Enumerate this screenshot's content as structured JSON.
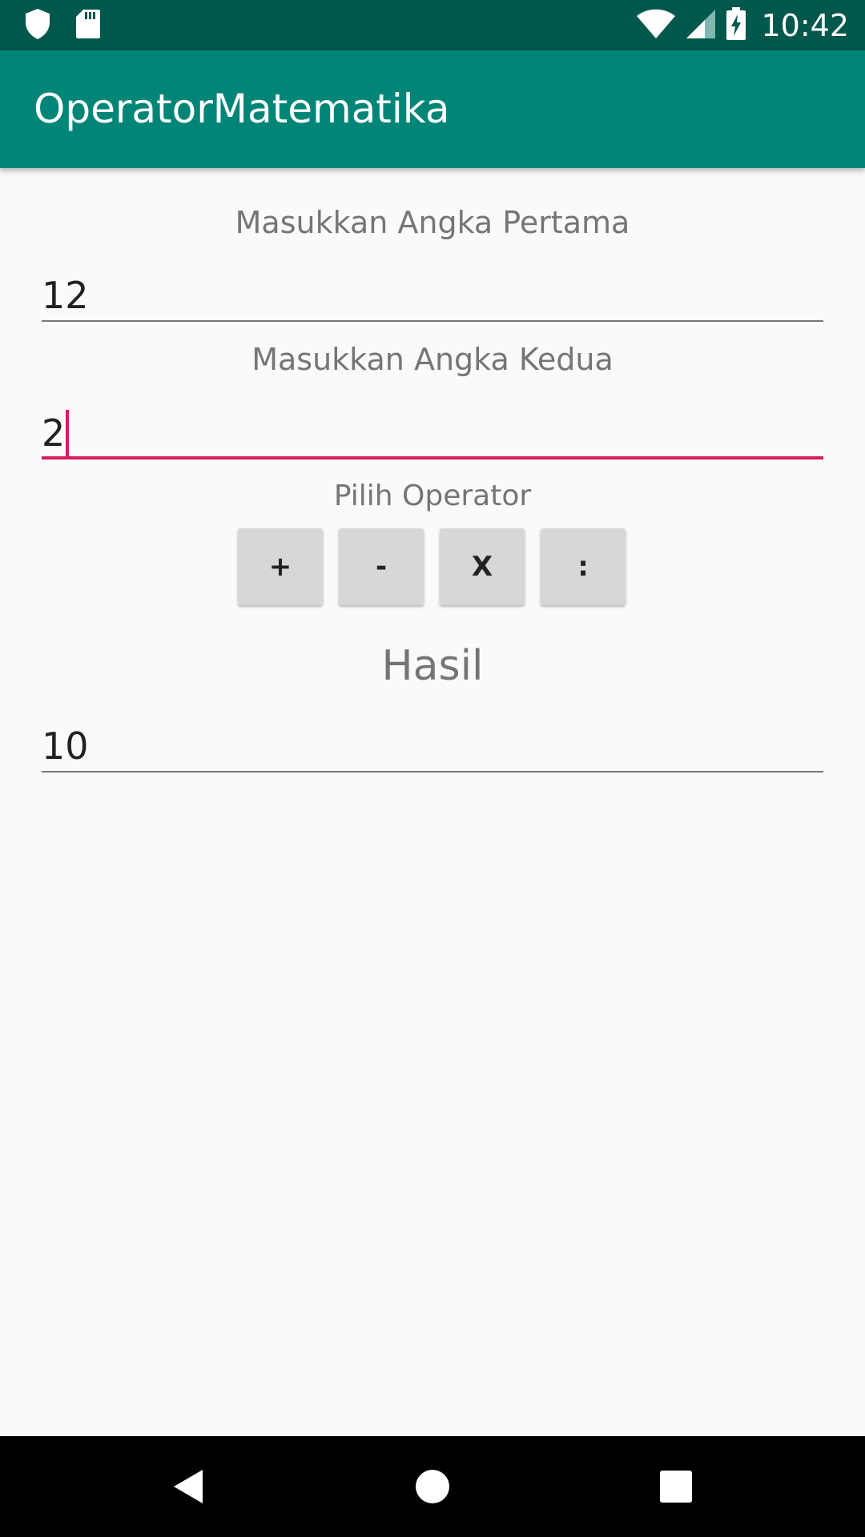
{
  "status_bar": {
    "time": "10:42",
    "icons": [
      "shield-icon",
      "sd-card-icon",
      "wifi-icon",
      "signal-icon",
      "battery-charging-icon"
    ]
  },
  "app_bar": {
    "title": "OperatorMatematika"
  },
  "form": {
    "first_label": "Masukkan Angka Pertama",
    "first_value": "12",
    "second_label": "Masukkan Angka Kedua",
    "second_value": "2",
    "operator_label": "Pilih Operator",
    "operators": [
      "+",
      "-",
      "X",
      ":"
    ],
    "result_label": "Hasil",
    "result_value": "10"
  },
  "nav_bar": {
    "icons": [
      "back-icon",
      "home-icon",
      "recents-icon"
    ]
  },
  "colors": {
    "status_bar": "#00574b",
    "app_bar": "#008577",
    "accent": "#d81b60",
    "button": "#d6d7d7"
  }
}
